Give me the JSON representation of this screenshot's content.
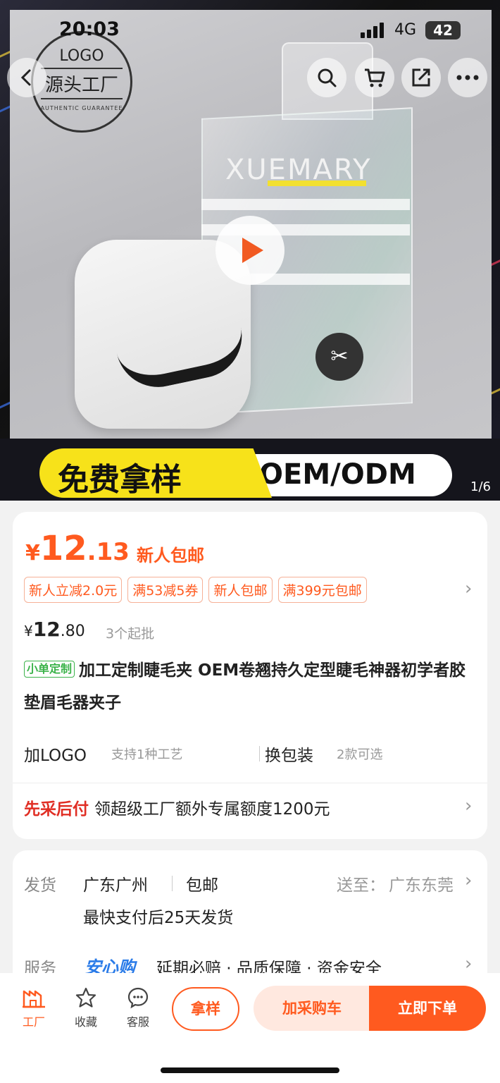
{
  "status_bar": {
    "time": "20:03",
    "network": "4G",
    "battery": "42"
  },
  "hero": {
    "logo_stamp": {
      "line1": "LOGO",
      "line2": "源头工厂",
      "line3": "AUTHENTIC GUARANTEE"
    },
    "product_box_title": "XUEMARY",
    "banner_left": "免费拿样",
    "banner_right": "OEM/ODM",
    "page_indicator": "1/6",
    "icons": [
      "back-icon",
      "search-icon",
      "cart-icon",
      "share-icon",
      "more-icon",
      "play-icon"
    ]
  },
  "price": {
    "currency": "¥",
    "integer": "12",
    "decimal": ".13",
    "note": "新人包邮",
    "coupons": [
      "新人立减2.0元",
      "满53减5券",
      "新人包邮",
      "满399元包邮"
    ],
    "original_currency": "¥",
    "original_integer": "12",
    "original_decimal": ".80",
    "moq": "3个起批"
  },
  "product": {
    "tag": "小单定制",
    "title": "加工定制睫毛夹 OEM卷翘持久定型睫毛神器初学者胶垫眉毛器夹子"
  },
  "options": {
    "logo_label": "加LOGO",
    "logo_sub": "支持1种工艺",
    "pack_label": "换包装",
    "pack_sub": "2款可选"
  },
  "credit": {
    "label": "先采后付",
    "text": "领超级工厂额外专属额度1200元"
  },
  "shipping": {
    "label": "发货",
    "origin": "广东广州",
    "free": "包邮",
    "dest_label": "送至：",
    "dest": "广东东莞",
    "eta": "最快支付后25天发货"
  },
  "service": {
    "label": "服务",
    "brand": "安心购",
    "text": "延期必赔 · 品质保障 · 资金安全"
  },
  "bottom_bar": {
    "tabs": [
      {
        "label": "工厂",
        "icon": "factory-icon"
      },
      {
        "label": "收藏",
        "icon": "star-icon"
      },
      {
        "label": "客服",
        "icon": "chat-icon"
      }
    ],
    "sample_button": "拿样",
    "cart_button": "加采购车",
    "buy_button": "立即下单"
  },
  "colors": {
    "accent": "#ff5a1f",
    "credit_red": "#e02e24",
    "tag_green": "#3bb34a",
    "brand_blue": "#2a7be8"
  }
}
